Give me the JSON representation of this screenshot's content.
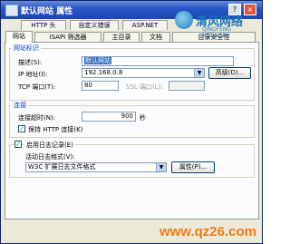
{
  "window": {
    "title": "默认网站 属性",
    "help_button": "?",
    "close_button": "×"
  },
  "tabs_row1": [
    "HTTP 头",
    "自定义错误",
    "ASP.NET"
  ],
  "tabs_row2": [
    "网站",
    "ISAPI 筛选器",
    "主目录",
    "文档",
    "目录安全性"
  ],
  "logo": {
    "text": "清风网络",
    "sub": "QINGFENG NETWORK"
  },
  "site_id": {
    "group_label": "网站标识",
    "description_label": "描述(S):",
    "description_value": "默认网站",
    "ip_label": "IP 地址(I):",
    "ip_value": "192.168.0.8",
    "advanced_button": "高级(D)...",
    "tcp_label": "TCP 端口(T):",
    "tcp_value": "80",
    "ssl_label": "SSL 端口(L):",
    "ssl_value": ""
  },
  "connection": {
    "group_label": "连接",
    "timeout_label": "连接超时(N):",
    "timeout_value": "900",
    "timeout_unit": "秒",
    "keepalive_label": "保持 HTTP 连接(K)",
    "keepalive_checked": true
  },
  "logging": {
    "enable_label": "启用日志记录(E)",
    "enable_checked": true,
    "format_label": "活动日志格式(V):",
    "format_value": "W3C 扩展日志文件格式",
    "properties_button": "属性(P)..."
  },
  "watermark": "www.qz26.com",
  "colors": {
    "title_bar": "#2a56c6",
    "group_label": "#0046d5",
    "watermark": "#f07a12"
  }
}
